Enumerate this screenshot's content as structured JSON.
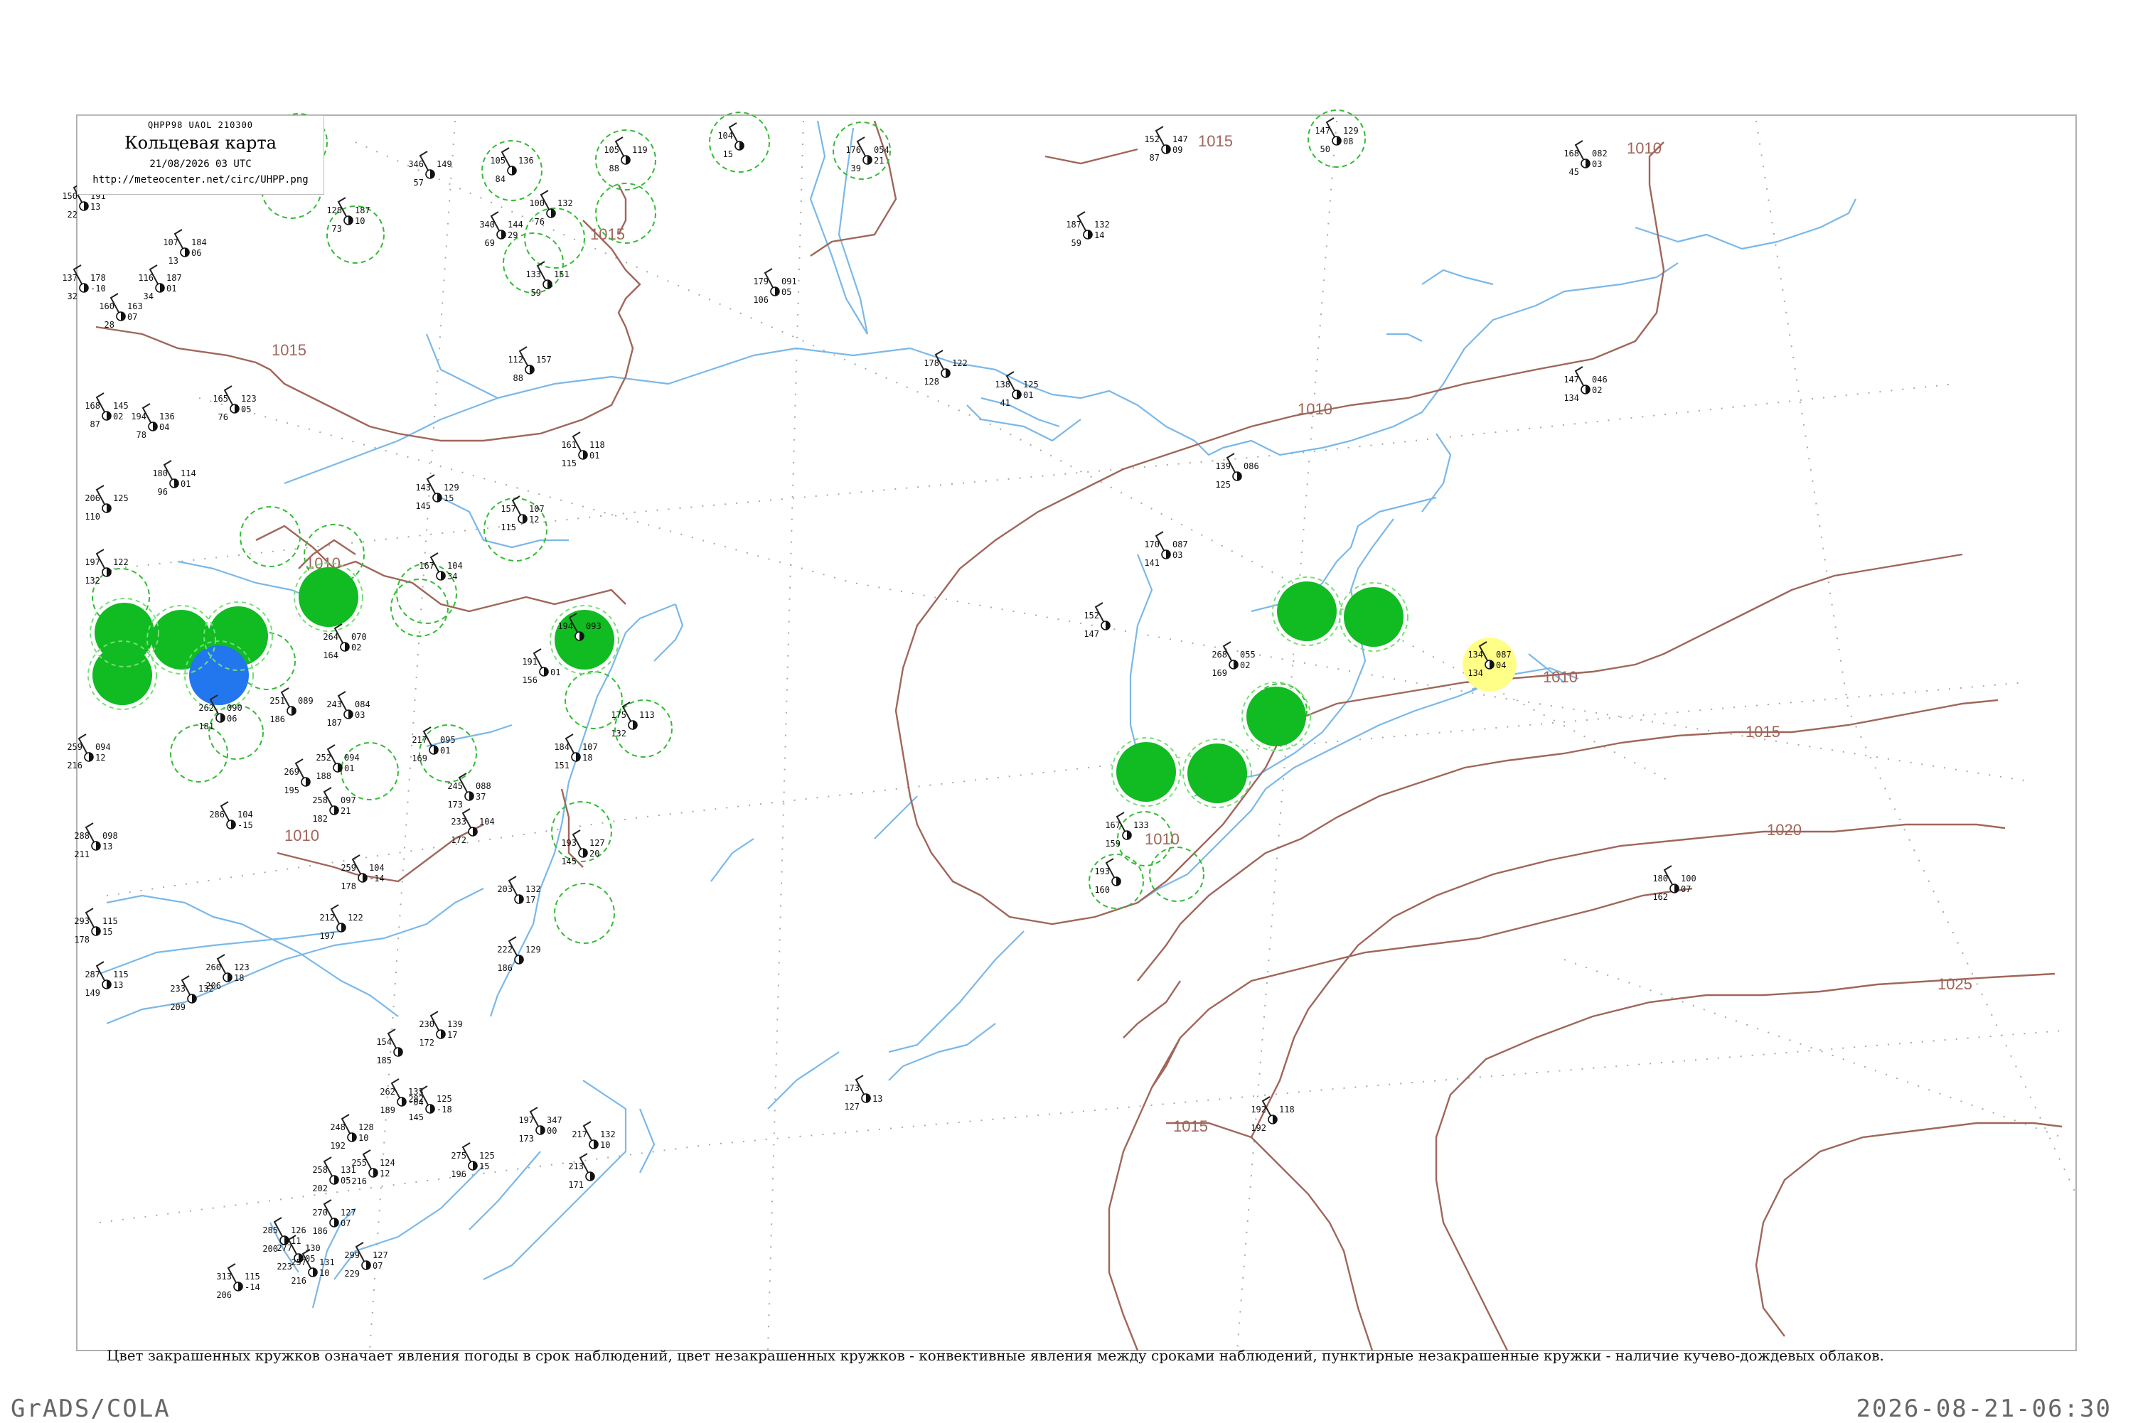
{
  "header": {
    "code": "QHPP98  UAOL  210300",
    "title": "Кольцевая карта",
    "datetime": "21/08/2026 03 UTC",
    "url": "http://meteocenter.net/circ/UHPP.png"
  },
  "isobars": {
    "labels": [
      "1015",
      "1015",
      "1010",
      "1010",
      "1015",
      "1020",
      "1025",
      "1015"
    ],
    "color": "#a0665a"
  },
  "colors": {
    "coast": "#7ab8e8",
    "filled_green": "#11bb22",
    "filled_blue": "#2277ee",
    "filled_yellow": "#ffff88",
    "dashed_ring": "#33bb33",
    "grid": "#9a9a9a"
  },
  "stations": [
    {
      "temp": "134",
      "dew": "134",
      "pressure": "087",
      "tendency": "04",
      "fill": "yellow"
    },
    {
      "temp": "180",
      "dew": "162",
      "pressure": "100",
      "tendency": "07",
      "fill": "none"
    },
    {
      "temp": "147",
      "dew": "134",
      "pressure": "046",
      "tendency": "02",
      "fill": "none"
    },
    {
      "temp": "168",
      "dew": "45",
      "pressure": "082",
      "tendency": "03",
      "fill": "none"
    },
    {
      "temp": "192",
      "dew": "192",
      "pressure": "118",
      "tendency": "",
      "fill": "none"
    },
    {
      "temp": "173",
      "dew": "127",
      "pressure": "",
      "tendency": "13",
      "fill": "none"
    },
    {
      "temp": "179",
      "dew": "106",
      "pressure": "091",
      "tendency": "05",
      "fill": "none"
    },
    {
      "temp": "176",
      "dew": "39",
      "pressure": "054",
      "tendency": "21",
      "fill": "none"
    },
    {
      "temp": "104",
      "dew": "15",
      "pressure": "",
      "tendency": "",
      "fill": "none"
    },
    {
      "temp": "105",
      "dew": "88",
      "pressure": "119",
      "tendency": "",
      "fill": "none"
    },
    {
      "temp": "268",
      "dew": "169",
      "pressure": "055",
      "tendency": "02",
      "fill": "none"
    },
    {
      "temp": "170",
      "dew": "141",
      "pressure": "087",
      "tendency": "03",
      "fill": "none"
    },
    {
      "temp": "152",
      "dew": "147",
      "pressure": "",
      "tendency": "",
      "fill": "none"
    },
    {
      "temp": "139",
      "dew": "125",
      "pressure": "086",
      "tendency": "",
      "fill": "none"
    },
    {
      "temp": "178",
      "dew": "128",
      "pressure": "122",
      "tendency": "",
      "fill": "none"
    },
    {
      "temp": "138",
      "dew": "41",
      "pressure": "125",
      "tendency": "01",
      "fill": "none"
    },
    {
      "temp": "187",
      "dew": "59",
      "pressure": "132",
      "tendency": "14",
      "fill": "none"
    },
    {
      "temp": "152",
      "dew": "87",
      "pressure": "147",
      "tendency": "09",
      "fill": "none"
    },
    {
      "temp": "147",
      "dew": "50",
      "pressure": "129",
      "tendency": "08",
      "fill": "none"
    },
    {
      "temp": "112",
      "dew": "88",
      "pressure": "157",
      "tendency": "",
      "fill": "none"
    },
    {
      "temp": "161",
      "dew": "115",
      "pressure": "118",
      "tendency": "01",
      "fill": "none"
    },
    {
      "temp": "191",
      "dew": "156",
      "pressure": "",
      "tendency": "01",
      "fill": "none"
    },
    {
      "temp": "245",
      "dew": "173",
      "pressure": "088",
      "tendency": "37",
      "fill": "none"
    },
    {
      "temp": "233",
      "dew": "172",
      "pressure": "104",
      "tendency": "",
      "fill": "none"
    },
    {
      "temp": "193",
      "dew": "145",
      "pressure": "127",
      "tendency": "20",
      "fill": "none"
    },
    {
      "temp": "203",
      "dew": "",
      "pressure": "132",
      "tendency": "17",
      "fill": "none"
    },
    {
      "temp": "222",
      "dew": "186",
      "pressure": "129",
      "tendency": "",
      "fill": "none"
    },
    {
      "temp": "288",
      "dew": "211",
      "pressure": "098",
      "tendency": "13",
      "fill": "none"
    },
    {
      "temp": "293",
      "dew": "178",
      "pressure": "115",
      "tendency": "15",
      "fill": "none"
    },
    {
      "temp": "287",
      "dew": "149",
      "pressure": "115",
      "tendency": "13",
      "fill": "none"
    },
    {
      "temp": "233",
      "dew": "209",
      "pressure": "132",
      "tendency": "",
      "fill": "none"
    },
    {
      "temp": "260",
      "dew": "206",
      "pressure": "123",
      "tendency": "18",
      "fill": "none"
    },
    {
      "temp": "212",
      "dew": "197",
      "pressure": "122",
      "tendency": "",
      "fill": "none"
    },
    {
      "temp": "259",
      "dew": "178",
      "pressure": "104",
      "tendency": "-14",
      "fill": "none"
    },
    {
      "temp": "252",
      "dew": "188",
      "pressure": "094",
      "tendency": "01",
      "fill": "none"
    },
    {
      "temp": "269",
      "dew": "195",
      "pressure": "",
      "tendency": "",
      "fill": "none"
    },
    {
      "temp": "258",
      "dew": "182",
      "pressure": "097",
      "tendency": "21",
      "fill": "none"
    },
    {
      "temp": "259",
      "dew": "216",
      "pressure": "094",
      "tendency": "12",
      "fill": "none"
    },
    {
      "temp": "206",
      "dew": "110",
      "pressure": "125",
      "tendency": "",
      "fill": "none"
    },
    {
      "temp": "197",
      "dew": "132",
      "pressure": "122",
      "tendency": "",
      "fill": "none"
    },
    {
      "temp": "168",
      "dew": "87",
      "pressure": "145",
      "tendency": "02",
      "fill": "none"
    },
    {
      "temp": "194",
      "dew": "78",
      "pressure": "136",
      "tendency": "04",
      "fill": "none"
    },
    {
      "temp": "180",
      "dew": "96",
      "pressure": "114",
      "tendency": "01",
      "fill": "none"
    },
    {
      "temp": "165",
      "dew": "76",
      "pressure": "123",
      "tendency": "05",
      "fill": "none"
    },
    {
      "temp": "143",
      "dew": "145",
      "pressure": "129",
      "tendency": "15",
      "fill": "none"
    },
    {
      "temp": "157",
      "dew": "115",
      "pressure": "107",
      "tendency": "12",
      "fill": "none"
    },
    {
      "temp": "167",
      "dew": "",
      "pressure": "104",
      "tendency": "34",
      "fill": "none"
    },
    {
      "temp": "264",
      "dew": "164",
      "pressure": "070",
      "tendency": "02",
      "fill": "none"
    },
    {
      "temp": "243",
      "dew": "187",
      "pressure": "084",
      "tendency": "03",
      "fill": "none"
    },
    {
      "temp": "217",
      "dew": "169",
      "pressure": "095",
      "tendency": "01",
      "fill": "none"
    },
    {
      "temp": "251",
      "dew": "186",
      "pressure": "089",
      "tendency": "",
      "fill": "none"
    },
    {
      "temp": "262",
      "dew": "181",
      "pressure": "090",
      "tendency": "06",
      "fill": "none"
    },
    {
      "temp": "286",
      "dew": "",
      "pressure": "104",
      "tendency": "-15",
      "fill": "none"
    },
    {
      "temp": "194",
      "dew": "",
      "pressure": "093",
      "tendency": "",
      "fill": "none"
    },
    {
      "temp": "184",
      "dew": "151",
      "pressure": "107",
      "tendency": "18",
      "fill": "none"
    },
    {
      "temp": "175",
      "dew": "132",
      "pressure": "113",
      "tendency": "",
      "fill": "none"
    },
    {
      "temp": "167",
      "dew": "159",
      "pressure": "133",
      "tendency": "",
      "fill": "none"
    },
    {
      "temp": "193",
      "dew": "160",
      "pressure": "",
      "tendency": "",
      "fill": "none"
    },
    {
      "temp": "346",
      "dew": "57",
      "pressure": "149",
      "tendency": "",
      "fill": "none"
    },
    {
      "temp": "105",
      "dew": "84",
      "pressure": "136",
      "tendency": "",
      "fill": "none"
    },
    {
      "temp": "340",
      "dew": "69",
      "pressure": "144",
      "tendency": "29",
      "fill": "none"
    },
    {
      "temp": "100",
      "dew": "76",
      "pressure": "132",
      "tendency": "",
      "fill": "none"
    },
    {
      "temp": "133",
      "dew": "59",
      "pressure": "151",
      "tendency": "",
      "fill": "none"
    },
    {
      "temp": "128",
      "dew": "73",
      "pressure": "187",
      "tendency": "10",
      "fill": "none"
    },
    {
      "temp": "107",
      "dew": "13",
      "pressure": "184",
      "tendency": "06",
      "fill": "none"
    },
    {
      "temp": "116",
      "dew": "34",
      "pressure": "187",
      "tendency": "01",
      "fill": "none"
    },
    {
      "temp": "137",
      "dew": "32",
      "pressure": "178",
      "tendency": "-10",
      "fill": "none"
    },
    {
      "temp": "160",
      "dew": "28",
      "pressure": "163",
      "tendency": "07",
      "fill": "none"
    },
    {
      "temp": "150",
      "dew": "22",
      "pressure": "191",
      "tendency": "13",
      "fill": "none"
    },
    {
      "temp": "197",
      "dew": "173",
      "pressure": "347",
      "tendency": "00",
      "fill": "none"
    },
    {
      "temp": "213",
      "dew": "171",
      "pressure": "",
      "tendency": "",
      "fill": "none"
    },
    {
      "temp": "217",
      "dew": "",
      "pressure": "132",
      "tendency": "10",
      "fill": "none"
    },
    {
      "temp": "230",
      "dew": "172",
      "pressure": "139",
      "tendency": "17",
      "fill": "none"
    },
    {
      "temp": "154",
      "dew": "185",
      "pressure": "",
      "tendency": "",
      "fill": "none"
    },
    {
      "temp": "262",
      "dew": "189",
      "pressure": "133",
      "tendency": "-04",
      "fill": "none"
    },
    {
      "temp": "282",
      "dew": "145",
      "pressure": "125",
      "tendency": "-18",
      "fill": "none"
    },
    {
      "temp": "275",
      "dew": "196",
      "pressure": "125",
      "tendency": "15",
      "fill": "none"
    },
    {
      "temp": "248",
      "dew": "192",
      "pressure": "128",
      "tendency": "10",
      "fill": "none"
    },
    {
      "temp": "255",
      "dew": "216",
      "pressure": "124",
      "tendency": "12",
      "fill": "none"
    },
    {
      "temp": "258",
      "dew": "202",
      "pressure": "131",
      "tendency": "05",
      "fill": "none"
    },
    {
      "temp": "270",
      "dew": "186",
      "pressure": "127",
      "tendency": "07",
      "fill": "none"
    },
    {
      "temp": "277",
      "dew": "223",
      "pressure": "130",
      "tendency": "05",
      "fill": "none"
    },
    {
      "temp": "285",
      "dew": "200",
      "pressure": "126",
      "tendency": "11",
      "fill": "none"
    },
    {
      "temp": "257",
      "dew": "216",
      "pressure": "131",
      "tendency": "10",
      "fill": "none"
    },
    {
      "temp": "299",
      "dew": "229",
      "pressure": "127",
      "tendency": "07",
      "fill": "none"
    },
    {
      "temp": "313",
      "dew": "206",
      "pressure": "115",
      "tendency": "-14",
      "fill": "none"
    }
  ],
  "caption": "Цвет закрашенных кружков означает явления погоды в срок наблюдений, цвет незакрашенных кружков - конвективные явления между сроками наблюдений, пунктирные незакрашенные кружки - наличие кучево-дождевых облаков.",
  "footer": {
    "left": "GrADS/COLA",
    "right": "2026-08-21-06:30"
  }
}
